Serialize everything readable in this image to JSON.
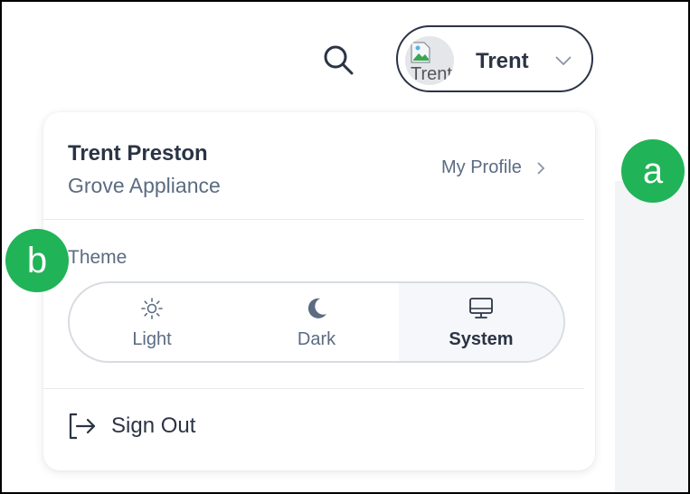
{
  "header": {
    "user_button": {
      "name": "Trent",
      "avatar_alt": "Trent"
    }
  },
  "dropdown": {
    "user_full_name": "Trent Preston",
    "company": "Grove Appliance",
    "my_profile_label": "My Profile",
    "theme_label": "Theme",
    "theme_options": [
      {
        "label": "Light",
        "icon": "sun-icon",
        "selected": false
      },
      {
        "label": "Dark",
        "icon": "moon-icon",
        "selected": false
      },
      {
        "label": "System",
        "icon": "monitor-icon",
        "selected": true
      }
    ],
    "sign_out_label": "Sign Out"
  },
  "callouts": {
    "a": "a",
    "b": "b"
  },
  "colors": {
    "text_primary": "#2b3445",
    "text_secondary": "#5b6b82",
    "callout_green": "#21b357",
    "selected_bg": "#f5f7fa"
  }
}
